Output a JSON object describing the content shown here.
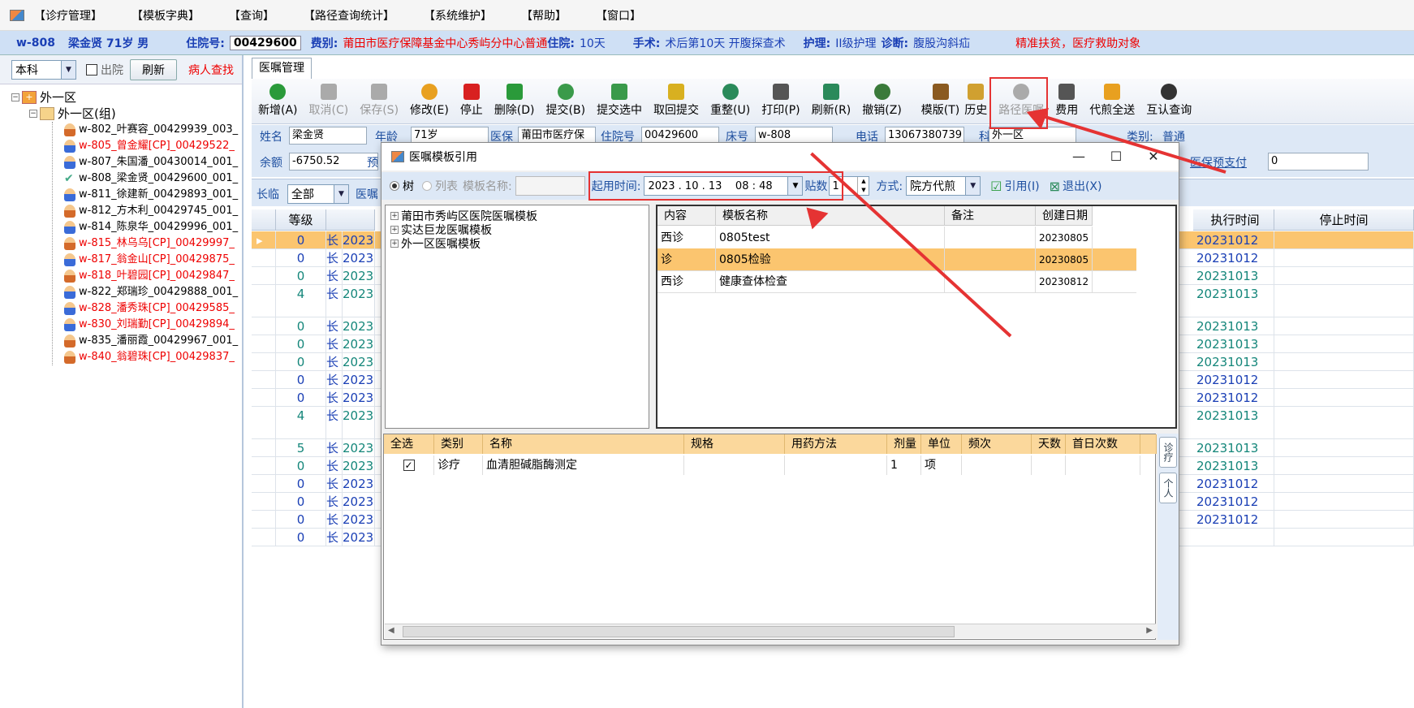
{
  "menu": [
    "【诊疗管理】",
    "【模板字典】",
    "【查询】",
    "【路径查询统计】",
    "【系统维护】",
    "【帮助】",
    "【窗口】"
  ],
  "patient": {
    "bed": "w-808",
    "name_age_sex": "梁金贤 71岁 男",
    "inpatient_label": "住院号:",
    "inpatient_no": "00429600",
    "fee_label": "费别:",
    "fee_value": "莆田市医疗保障基金中心秀屿分中心普通",
    "stay_label": "住院:",
    "stay_value": "10天",
    "surgery_label": "手术:",
    "surgery_value": "术后第10天 开腹探查术",
    "nursing_label": "护理:",
    "nursing_value": "II级护理",
    "diag_label": "诊断:",
    "diag_value": "腹股沟斜疝",
    "poverty": "精准扶贫，医疗救助对象"
  },
  "left": {
    "dept": "本科",
    "discharge": "出院",
    "refresh": "刷新",
    "find": "病人查找",
    "root": "外一区",
    "group": "外一区(组)",
    "patients": [
      {
        "t": "w-802_叶赛容_00429939_003_",
        "red": false,
        "f": true
      },
      {
        "t": "w-805_曾金耀[CP]_00429522_",
        "red": true,
        "f": false
      },
      {
        "t": "w-807_朱国潘_00430014_001_",
        "red": false,
        "f": false
      },
      {
        "t": "w-808_梁金贤_00429600_001_",
        "red": false,
        "f": false,
        "chk": true
      },
      {
        "t": "w-811_徐建新_00429893_001_",
        "red": false,
        "f": false
      },
      {
        "t": "w-812_方木利_00429745_001_",
        "red": false,
        "f": true
      },
      {
        "t": "w-814_陈泉华_00429996_001_",
        "red": false,
        "f": false
      },
      {
        "t": "w-815_林乌乌[CP]_00429997_",
        "red": true,
        "f": true
      },
      {
        "t": "w-817_翁金山[CP]_00429875_",
        "red": true,
        "f": false
      },
      {
        "t": "w-818_叶碧园[CP]_00429847_",
        "red": true,
        "f": true
      },
      {
        "t": "w-822_郑瑞珍_00429888_001_",
        "red": false,
        "f": false
      },
      {
        "t": "w-828_潘秀珠[CP]_00429585_",
        "red": true,
        "f": false
      },
      {
        "t": "w-830_刘瑞勤[CP]_00429894_",
        "red": true,
        "f": false
      },
      {
        "t": "w-835_潘丽霞_00429967_001_",
        "red": false,
        "f": true
      },
      {
        "t": "w-840_翁碧珠[CP]_00429837_",
        "red": true,
        "f": true
      }
    ]
  },
  "tab": "医嘱管理",
  "toolbar": [
    {
      "l": "新增(A)",
      "c": "#2a9a3a",
      "dis": false
    },
    {
      "l": "取消(C)",
      "c": "#aaa",
      "dis": true
    },
    {
      "l": "保存(S)",
      "c": "#aaa",
      "dis": true
    },
    {
      "l": "修改(E)",
      "c": "#e8a020",
      "dis": false
    },
    {
      "l": "停止",
      "c": "#d82020",
      "dis": false
    },
    {
      "l": "删除(D)",
      "c": "#2a9a3a",
      "dis": false
    },
    {
      "l": "提交(B)",
      "c": "#3a9a4a",
      "dis": false
    },
    {
      "l": "提交选中",
      "c": "#3a9a4a",
      "dis": false
    },
    {
      "l": "取回提交",
      "c": "#d8b020",
      "dis": false
    },
    {
      "l": "重整(U)",
      "c": "#2a8a5a",
      "dis": false
    },
    {
      "l": "打印(P)",
      "c": "#555",
      "dis": false
    },
    {
      "l": "刷新(R)",
      "c": "#2a8a5a",
      "dis": false
    },
    {
      "l": "撤销(Z)",
      "c": "#3a7a3a",
      "dis": false
    },
    {
      "l": "模版(T)",
      "c": "#8a5a20",
      "dis": false
    },
    {
      "l": "历史",
      "c": "#d0a030",
      "dis": false
    },
    {
      "l": "路径医嘱",
      "c": "#aaa",
      "dis": true
    },
    {
      "l": "费用",
      "c": "#555",
      "dis": false
    },
    {
      "l": "代煎全送",
      "c": "#e8a020",
      "dis": false
    },
    {
      "l": "互认查询",
      "c": "#333",
      "dis": false
    }
  ],
  "info": {
    "name_l": "姓名",
    "name_v": "梁金贤",
    "age_l": "年龄",
    "age_v": "71岁",
    "ins_l": "医保",
    "ins_v": "莆田市医疗保",
    "inp_l": "住院号",
    "inp_v": "00429600",
    "bed_l": "床号",
    "bed_v": "w-808",
    "tel_l": "电话",
    "tel_v": "13067380739",
    "dept_l": "科别",
    "dept_v": "外一区",
    "type_l": "类别:",
    "type_v": "普通",
    "bal_l": "余额",
    "bal_v": "-6750.52",
    "pre_l": "预",
    "prepay_l": "医保预支付",
    "prepay_v": "0"
  },
  "filter": {
    "long_l": "长临",
    "long_v": "全部",
    "order_l": "医嘱"
  },
  "grid": {
    "headers": {
      "level": "等级",
      "exec": "执行时间",
      "stop": "停止时间"
    },
    "rows": [
      {
        "lv": "0",
        "k": "长",
        "d": "2023",
        "e": "20231012",
        "c": "blue",
        "sel": true
      },
      {
        "lv": "0",
        "k": "长",
        "d": "2023",
        "e": "20231012",
        "c": "blue"
      },
      {
        "lv": "0",
        "k": "长",
        "d": "2023",
        "e": "20231013",
        "c": "teal"
      },
      {
        "lv": "4",
        "k": "长",
        "d": "2023",
        "e": "20231013",
        "c": "teal",
        "tall": true
      },
      {
        "lv": "0",
        "k": "长",
        "d": "2023",
        "e": "20231013",
        "c": "teal"
      },
      {
        "lv": "0",
        "k": "长",
        "d": "2023",
        "e": "20231013",
        "c": "teal"
      },
      {
        "lv": "0",
        "k": "长",
        "d": "2023",
        "e": "20231013",
        "c": "teal"
      },
      {
        "lv": "0",
        "k": "长",
        "d": "2023",
        "e": "20231012",
        "c": "blue"
      },
      {
        "lv": "0",
        "k": "长",
        "d": "2023",
        "e": "20231012",
        "c": "blue"
      },
      {
        "lv": "4",
        "k": "长",
        "d": "2023",
        "e": "20231013",
        "c": "teal",
        "tall": true
      },
      {
        "lv": "5",
        "k": "长",
        "d": "2023",
        "e": "20231013",
        "c": "teal"
      },
      {
        "lv": "0",
        "k": "长",
        "d": "2023",
        "e": "20231013",
        "c": "teal"
      },
      {
        "lv": "0",
        "k": "长",
        "d": "2023",
        "e": "20231012",
        "c": "blue"
      },
      {
        "lv": "0",
        "k": "长",
        "d": "2023",
        "e": "20231012",
        "c": "blue"
      },
      {
        "lv": "0",
        "k": "长",
        "d": "2023",
        "e": "20231012",
        "c": "blue"
      },
      {
        "lv": "0",
        "k": "长",
        "d": "2023",
        "e": "",
        "c": "blue"
      }
    ]
  },
  "dialog": {
    "title": "医嘱模板引用",
    "tree_l": "树",
    "list_l": "列表",
    "tplname_l": "模板名称:",
    "start_l": "起用时间:",
    "start_v": "2023 . 10 . 13    08 : 48",
    "paste_l": "贴数",
    "paste_v": "1",
    "mode_l": "方式:",
    "mode_v": "院方代煎",
    "use_btn": "引用(I)",
    "exit_btn": "退出(X)",
    "tree": [
      "莆田市秀屿区医院医嘱模板",
      "实达巨龙医嘱模板",
      "外一区医嘱模板"
    ],
    "tpl_headers": [
      "内容",
      "模板名称",
      "备注",
      "创建日期"
    ],
    "tpl_rows": [
      {
        "a": "西诊",
        "b": "0805test",
        "c": "",
        "d": "20230805"
      },
      {
        "a": "诊",
        "b": "0805检验",
        "c": "",
        "d": "20230805",
        "sel": true
      },
      {
        "a": "西诊",
        "b": "健康查体检查",
        "c": "",
        "d": "20230812"
      }
    ],
    "det_headers": [
      "全选",
      "类别",
      "名称",
      "规格",
      "用药方法",
      "剂量",
      "单位",
      "频次",
      "天数",
      "首日次数"
    ],
    "det_row": {
      "checked": "✓",
      "cat": "诊疗",
      "name": "血清胆碱脂酶测定",
      "dose": "1",
      "unit": "项"
    },
    "side_tabs": [
      "诊疗",
      "个人"
    ]
  }
}
